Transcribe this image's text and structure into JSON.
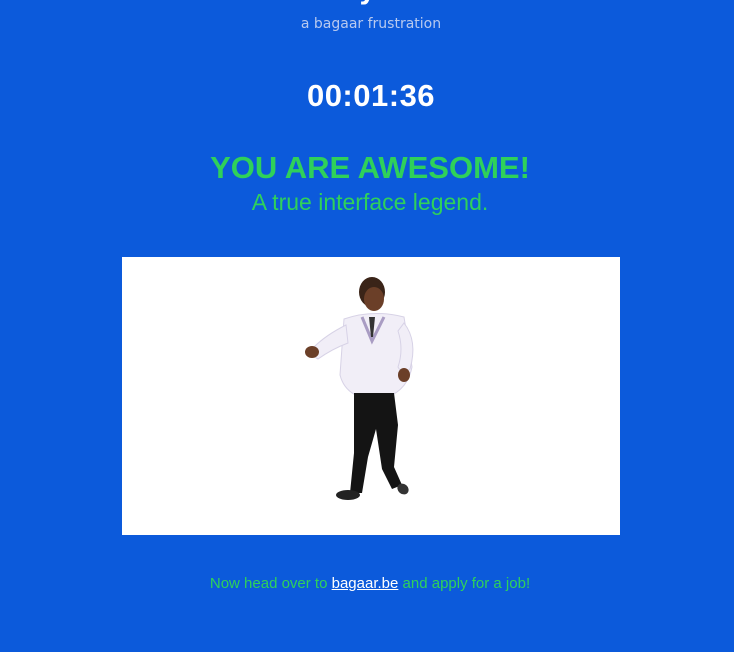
{
  "header": {
    "subtitle": "a bagaar frustration"
  },
  "timer": {
    "value": "00:01:36"
  },
  "result": {
    "headline": "YOU ARE AWESOME!",
    "tagline": "A true interface legend."
  },
  "media": {
    "icon": "dancing-person-animation"
  },
  "footer": {
    "text_before": "Now head over to ",
    "link_text": "bagaar.be",
    "text_after": " and apply for a job!"
  },
  "colors": {
    "background": "#0c5adb",
    "accent_green": "#2fd15a",
    "text_white": "#ffffff"
  }
}
